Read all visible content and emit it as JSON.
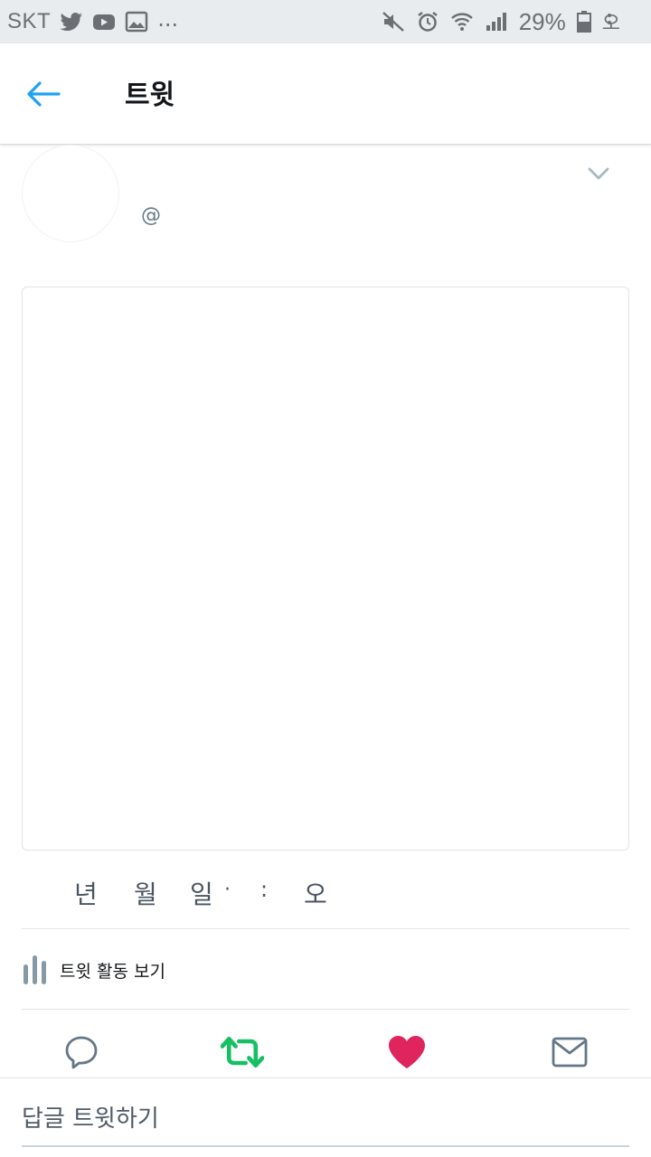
{
  "status_bar": {
    "carrier": "SKT",
    "more_notifications": "...",
    "battery_percent": "29%",
    "trailing_char": "오",
    "notification_icons": [
      "twitter-bird-icon",
      "youtube-icon",
      "gallery-icon"
    ],
    "system_icons": [
      "mute-icon",
      "alarm-icon",
      "wifi-icon",
      "signal-icon",
      "battery-icon"
    ]
  },
  "app_bar": {
    "title": "트윗"
  },
  "tweet": {
    "handle": "@",
    "timestamp": {
      "year": "년",
      "month": "월",
      "day": "일",
      "separator": "·",
      "colon": ":",
      "meridiem": "오"
    },
    "activity_label": "트윗 활동 보기"
  },
  "reply": {
    "placeholder": "답글 트윗하기"
  },
  "colors": {
    "accent_blue": "#1da1f2",
    "retweet_green": "#17bf63",
    "like_red": "#e0245e",
    "icon_gray": "#657786",
    "status_bar_bg": "#e9ecef"
  }
}
